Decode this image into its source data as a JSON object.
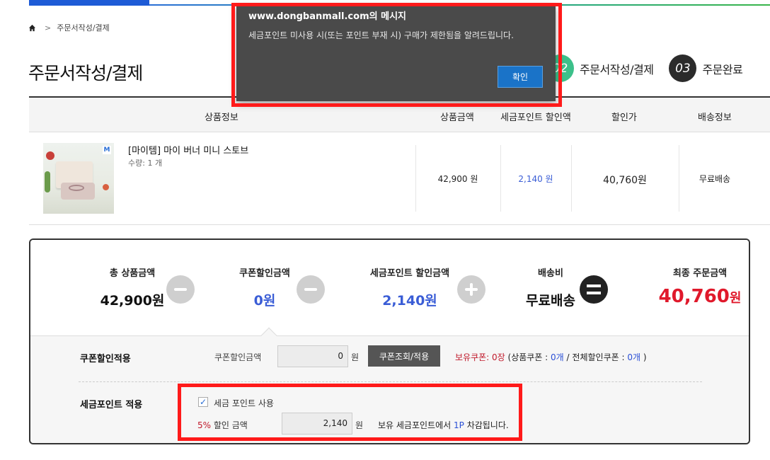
{
  "breadcrumb": {
    "home_icon": "home-icon",
    "separator": ">",
    "current": "주문서작성/결제"
  },
  "page": {
    "title": "주문서작성/결제"
  },
  "steps": [
    {
      "number": "02",
      "label": "주문서작성/결제",
      "color": "#3cc08a"
    },
    {
      "number": "03",
      "label": "주문완료",
      "color": "#2b2b2b"
    }
  ],
  "table": {
    "headers": {
      "product": "상품정보",
      "price": "상품금액",
      "point_discount": "세금포인트 할인액",
      "sale_price": "할인가",
      "shipping": "배송정보"
    },
    "rows": [
      {
        "name": "[마이템] 마이 버너 미니 스토브",
        "qty": "수량: 1 개",
        "price": "42,900 원",
        "point_discount": "2,140 원",
        "sale_price": "40,760원",
        "shipping": "무료배송"
      }
    ]
  },
  "summary": {
    "total_label": "총 상품금액",
    "total_value": "42,900원",
    "coupon_label": "쿠폰할인금액",
    "coupon_value": "0원",
    "point_label": "세금포인트 할인금액",
    "point_value": "2,140원",
    "shipping_label": "배송비",
    "shipping_value": "무료배송",
    "final_label": "최종 주문금액",
    "final_value": "40,760",
    "final_unit": "원"
  },
  "coupon": {
    "section_title": "쿠폰할인적용",
    "amount_label": "쿠폰할인금액",
    "amount_value": "0",
    "unit": "원",
    "button_label": "쿠폰조회/적용",
    "owned_label": "보유쿠폰: 0장",
    "owned_detail_prefix": " (상품쿠폰 : ",
    "product_coupon_count": "0개",
    "owned_detail_mid": " / 전체할인쿠폰 : ",
    "total_coupon_count": "0개",
    "owned_detail_suffix": " )"
  },
  "tax_point": {
    "section_title": "세금포인트 적용",
    "checkbox_label": "세금 포인트 사용",
    "checked": true,
    "rate": "5%",
    "rate_label": " 할인 금액",
    "amount_value": "2,140",
    "unit": "원",
    "deduct_prefix": "보유 세금포인트에서 ",
    "deduct_points": "1P",
    "deduct_suffix": " 차감됩니다."
  },
  "dialog": {
    "title": "www.dongbanmall.com의 메시지",
    "message": "세금포인트 미사용 시(또는 포인트 부재 시) 구매가 제한됨을 알려드립니다.",
    "ok_label": "확인"
  },
  "colors": {
    "accent_blue": "#3a5dd6",
    "final_red": "#e0192b",
    "highlight_frame": "#ff1a1a",
    "dialog_bg": "#4a4a4a"
  }
}
